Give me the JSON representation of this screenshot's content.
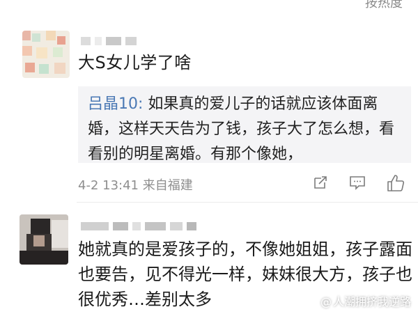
{
  "top_bar": {
    "hot_label": "按热度"
  },
  "comments": [
    {
      "text": "大S女儿学了啥",
      "quote": {
        "author": "吕晶10:",
        "text": "如果真的爱儿子的话就应该体面离婚，这样天天告为了钱，孩子大了怎么想，看看别的明星离婚。有那个像她，"
      },
      "time": "4-2 13:41",
      "location": "来自福建"
    },
    {
      "text": "她就真的是爱孩子的，不像她姐姐，孩子露面也要告，见不得光一样，妹妹很大方，孩子也很优秀…差别太多"
    }
  ],
  "actions": {
    "share_icon": "share-icon",
    "comment_icon": "comment-icon",
    "like_icon": "thumbs-up-icon"
  },
  "watermark": {
    "text": "人潮拥挤我逆路",
    "icon": "at-icon"
  },
  "colors": {
    "quote_name": "#4a78b4",
    "quote_bg": "#f4f4f6",
    "meta": "#8e8e8e"
  }
}
